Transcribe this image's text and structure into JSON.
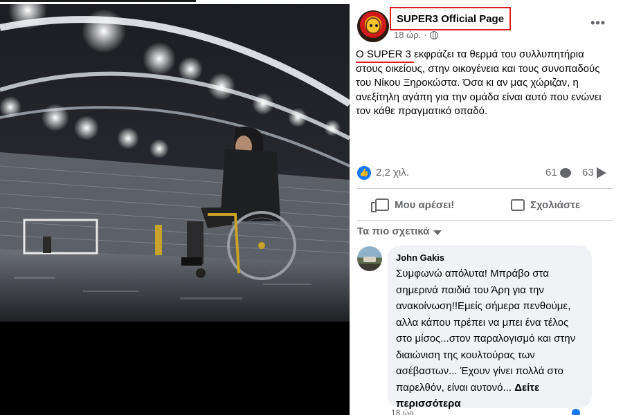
{
  "post": {
    "page_name": "SUPER3 Official Page",
    "time": "18 ώρ.",
    "separator": "·",
    "text": "Ο SUPER 3 εκφράζει τα θερμά του συλλυπητήρια στους οικείους, στην οικογένεια και τους συνοπαδούς του Νίκου Ξηροκώστα. Όσα κι αν μας χώριζαν, η ανεξίτηλη αγάπη για την ομάδα είναι αυτό που ενώνει τον κάθε πραγματικό οπαδό.",
    "more_label": "•••"
  },
  "stats": {
    "likes": "2,2 χιλ.",
    "comments": "61",
    "shares": "63"
  },
  "actions": {
    "like_label": "Μου αρέσει!",
    "comment_label": "Σχολιάστε"
  },
  "comments_section": {
    "sort_label": "Τα πιο σχετικά"
  },
  "comment": {
    "author": "John Gakis",
    "text": "Συμφωνώ απόλυτα! Μπράβο στα σημερινά παιδιά του Άρη για την ανακοίνωση!!Εμείς σήμερα πενθούμε, αλλα κάπου πρέπει να μπει ένα τέλος στο μίσος...στον παραλογισμό και στην διαιώνιση της κουλτούρας των ασέβαστων... Έχουν γίνει πολλά στο παρελθόν, είναι αυτονό...",
    "see_more": "Δείτε περισσότερα",
    "foot": "18 ώρ."
  },
  "colors": {
    "accent": "#1877f2",
    "highlight": "#e01b24",
    "muted": "#65676b"
  }
}
